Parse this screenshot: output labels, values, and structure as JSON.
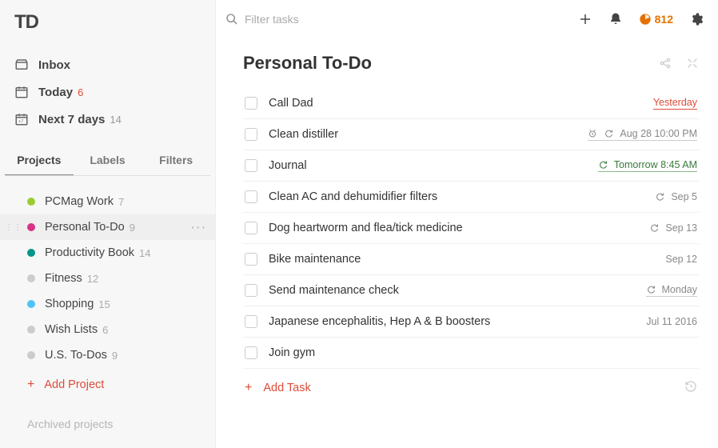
{
  "sidebar": {
    "nav": {
      "inbox": "Inbox",
      "today": "Today",
      "today_count": "6",
      "next7": "Next 7 days",
      "next7_count": "14"
    },
    "tabs": {
      "projects": "Projects",
      "labels": "Labels",
      "filters": "Filters"
    },
    "projects": [
      {
        "label": "PCMag Work",
        "count": "7",
        "color": "#9acd32"
      },
      {
        "label": "Personal To-Do",
        "count": "9",
        "color": "#d63384"
      },
      {
        "label": "Productivity Book",
        "count": "14",
        "color": "#009688"
      },
      {
        "label": "Fitness",
        "count": "12",
        "color": "#cccccc"
      },
      {
        "label": "Shopping",
        "count": "15",
        "color": "#4fc3f7"
      },
      {
        "label": "Wish Lists",
        "count": "6",
        "color": "#cccccc"
      },
      {
        "label": "U.S. To-Dos",
        "count": "9",
        "color": "#cccccc"
      }
    ],
    "add_project": "Add Project",
    "archived": "Archived projects"
  },
  "topbar": {
    "search_placeholder": "Filter tasks",
    "karma": "812"
  },
  "main": {
    "title": "Personal To-Do",
    "tasks": [
      {
        "title": "Call Dad",
        "due": "Yesterday",
        "status": "overdue",
        "reminder": false,
        "recurring": false
      },
      {
        "title": "Clean distiller",
        "due": "Aug 28 10:00 PM",
        "status": "scheduled",
        "reminder": true,
        "recurring": true
      },
      {
        "title": "Journal",
        "due": "Tomorrow 8:45 AM",
        "status": "soon",
        "reminder": false,
        "recurring": true
      },
      {
        "title": "Clean AC and dehumidifier filters",
        "due": "Sep 5",
        "status": "plain",
        "reminder": false,
        "recurring": true
      },
      {
        "title": "Dog heartworm and flea/tick medicine",
        "due": "Sep 13",
        "status": "plain",
        "reminder": false,
        "recurring": true
      },
      {
        "title": "Bike maintenance",
        "due": "Sep 12",
        "status": "plain",
        "reminder": false,
        "recurring": false
      },
      {
        "title": "Send maintenance check",
        "due": "Monday",
        "status": "scheduled",
        "reminder": false,
        "recurring": true
      },
      {
        "title": "Japanese encephalitis, Hep A & B boosters",
        "due": "Jul 11 2016",
        "status": "plain",
        "reminder": false,
        "recurring": false
      },
      {
        "title": "Join gym",
        "due": "",
        "status": "plain",
        "reminder": false,
        "recurring": false
      }
    ],
    "add_task": "Add Task"
  }
}
